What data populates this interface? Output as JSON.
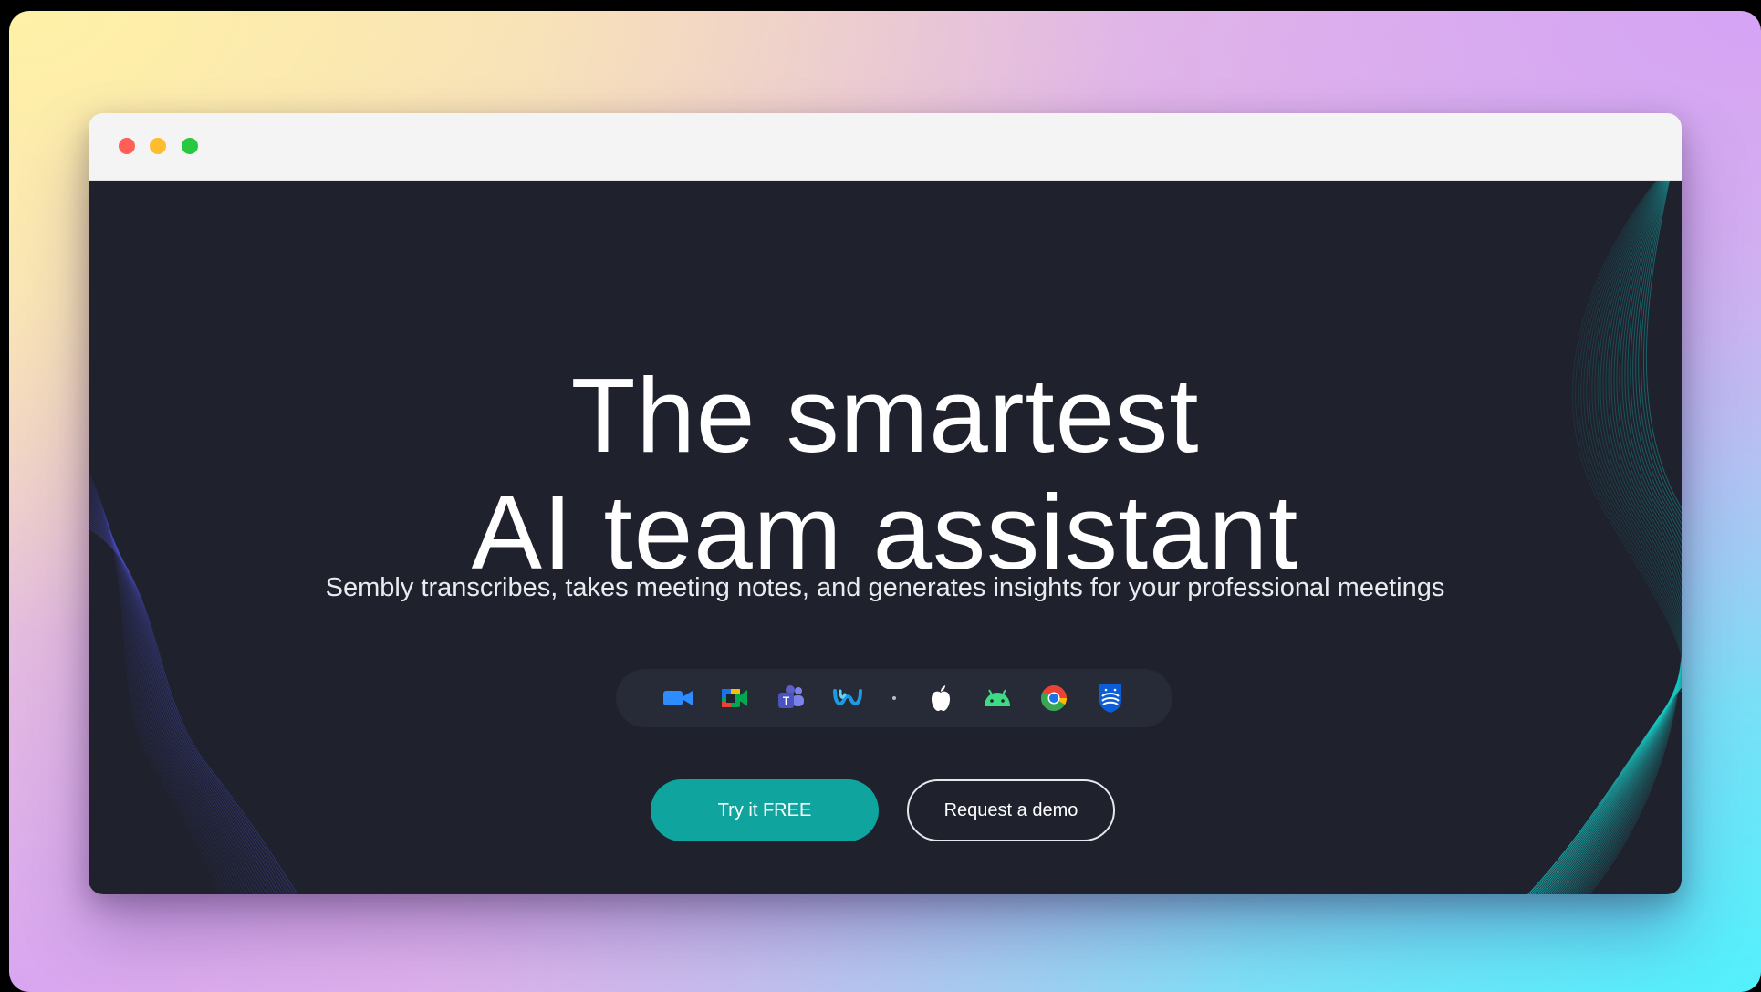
{
  "hero": {
    "title_line1": "The smartest",
    "title_line2": "AI team assistant",
    "subtitle": "Sembly transcribes, takes meeting notes, and generates insights for your professional meetings"
  },
  "integrations": [
    {
      "name": "zoom-icon",
      "color": "#2d8cff"
    },
    {
      "name": "google-meet-icon",
      "color": "#00a84f"
    },
    {
      "name": "microsoft-teams-icon",
      "color": "#5b5fc7"
    },
    {
      "name": "webex-icon",
      "color": "#1f9ae0"
    },
    {
      "name": "apple-icon",
      "color": "#ffffff"
    },
    {
      "name": "android-icon",
      "color": "#3ddc84"
    },
    {
      "name": "chrome-icon",
      "color": "#ea4335"
    },
    {
      "name": "philips-icon",
      "color": "#0b5ed7"
    }
  ],
  "buttons": {
    "primary_label": "Try it FREE",
    "secondary_label": "Request a demo"
  },
  "colors": {
    "page_bg": "#1f212d",
    "accent": "#0fa59e"
  }
}
